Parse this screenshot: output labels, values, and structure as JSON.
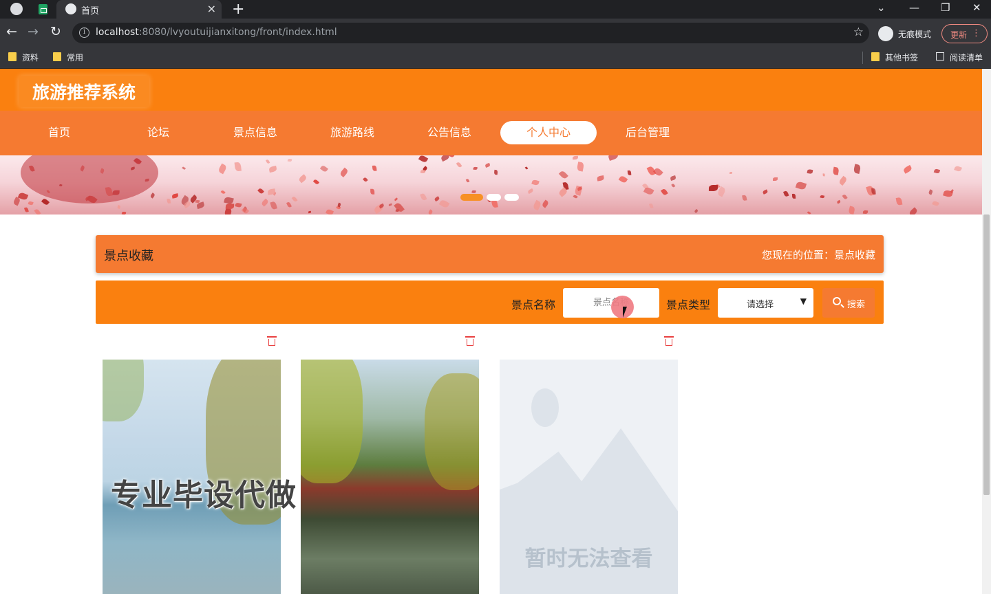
{
  "browser": {
    "tab_title": "首页",
    "tab_close": "×",
    "new_tab": "+",
    "url_host": "localhost",
    "url_rest": ":8080/lvyoutuijianxitong/front/index.html",
    "incognito_label": "无痕模式",
    "update_label": "更新",
    "bookmarks": [
      "资料",
      "常用"
    ],
    "bookmarks_right": [
      "其他书签",
      "阅读清单"
    ],
    "icons": {
      "back": "←",
      "forward": "→",
      "reload": "↻",
      "star": "☆",
      "minimize": "—",
      "restore": "❐",
      "close": "✕",
      "tab_search": "⌄",
      "menu": "⋮",
      "info": "i"
    }
  },
  "site": {
    "title": "旅游推荐系统",
    "nav": [
      "首页",
      "论坛",
      "景点信息",
      "旅游路线",
      "公告信息",
      "个人中心",
      "后台管理"
    ],
    "active_nav": "个人中心",
    "accent_color": "#fa800f",
    "nav_color": "#f57a31"
  },
  "banner": {
    "slide_count": 3,
    "active_slide": 1
  },
  "section": {
    "title": "景点收藏",
    "position_text": "您现在的位置：景点收藏"
  },
  "search": {
    "name_label": "景点名称",
    "name_placeholder": "景点名称",
    "type_label": "景点类型",
    "type_selected": "请选择",
    "search_button": "搜索"
  },
  "cards": [
    {
      "image": "lake-willow-photo"
    },
    {
      "image": "summer-palace-reflection-photo"
    },
    {
      "image": "placeholder",
      "placeholder_text": "暂时无法查看"
    }
  ],
  "watermark_text": "专业毕设代做"
}
